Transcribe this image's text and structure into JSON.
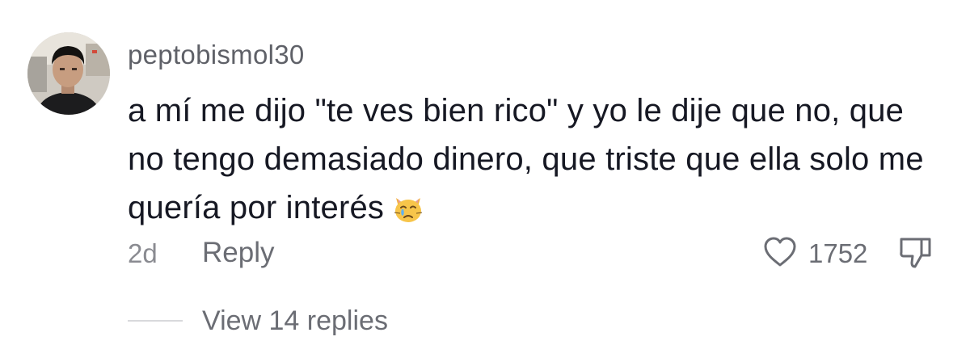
{
  "comment": {
    "username": "peptobismol30",
    "text": "a mí me dijo \"te ves bien rico\" y yo le dije que no, que no tengo demasiado dinero, que triste que ella solo me quería por interés",
    "emoji": "crying-cat-face-icon",
    "timestamp": "2d",
    "reply_label": "Reply",
    "like_count": "1752",
    "view_replies_label": "View 14 replies"
  },
  "colors": {
    "text_primary": "#161823",
    "text_secondary": "#6b6d74",
    "background": "#ffffff"
  }
}
